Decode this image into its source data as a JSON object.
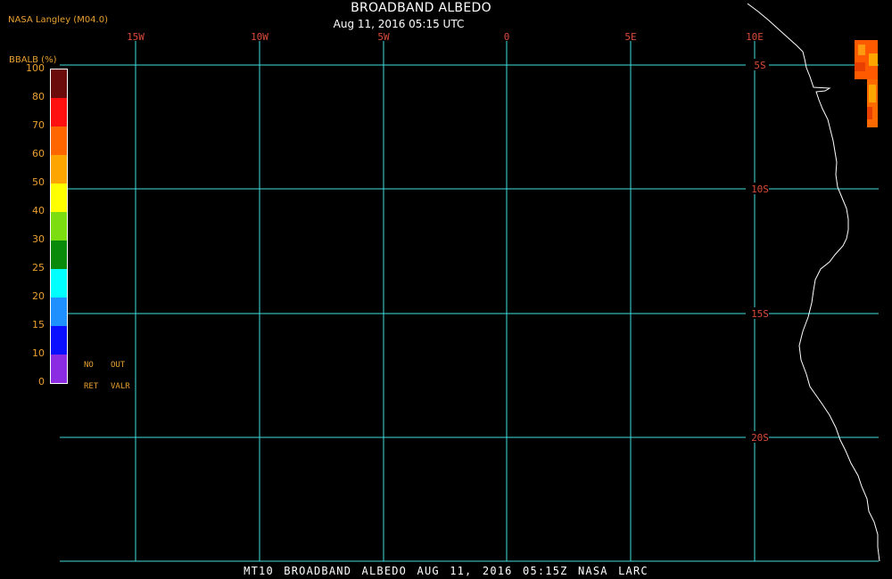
{
  "header": {
    "credit": "NASA Langley (M04.0)",
    "title": "BROADBAND ALBEDO",
    "subtitle": "Aug 11, 2016 05:15 UTC"
  },
  "footer": {
    "caption": "MT10  BROADBAND ALBEDO  AUG 11, 2016 05:15Z  NASA LARC"
  },
  "colorbar": {
    "title": "BBALB (%)",
    "ticks": [
      "0",
      "10",
      "15",
      "20",
      "25",
      "30",
      "40",
      "50",
      "60",
      "70",
      "80",
      "100"
    ],
    "colors": [
      "#8b2be2",
      "#0a10ff",
      "#1e90ff",
      "#00ffff",
      "#0a8a0a",
      "#7cdd10",
      "#ffff00",
      "#ffa500",
      "#ff6600",
      "#ff1010",
      "#6a0c0c"
    ],
    "key_no": "NO",
    "key_ret": "RET",
    "key_out": "OUT",
    "key_valr": "VALR"
  },
  "map": {
    "longitude_labels": [
      "15W",
      "10W",
      "5W",
      "0",
      "5E",
      "10E"
    ],
    "latitude_labels": [
      "5S",
      "10S",
      "15S",
      "20S"
    ],
    "grid_color": "#40e0e0",
    "coast_color": "#ffffff",
    "label_color": "#d94a3a"
  }
}
